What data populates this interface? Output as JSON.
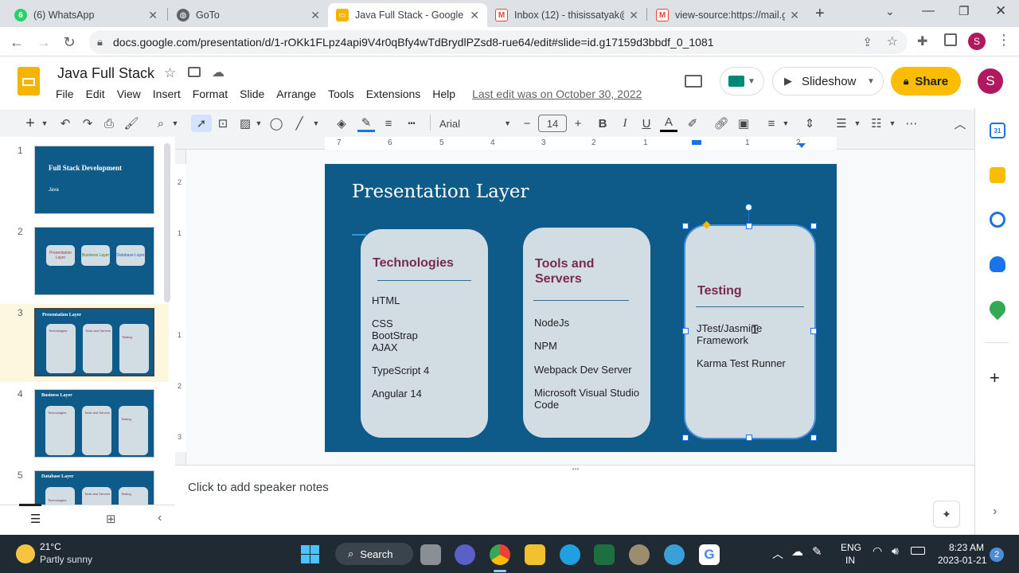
{
  "browser": {
    "tabs": [
      {
        "title": "(6) WhatsApp",
        "icon": "whatsapp-icon",
        "color": "#25d366",
        "badge": "6"
      },
      {
        "title": "GoTo",
        "icon": "globe-icon",
        "color": "#5f6368"
      },
      {
        "title": "Java Full Stack - Google S",
        "icon": "slides-icon",
        "color": "#f4b400",
        "active": true
      },
      {
        "title": "Inbox (12) - thisissatyak@",
        "icon": "gmail-icon",
        "color": "#ea4335"
      },
      {
        "title": "view-source:https://mail.g",
        "icon": "gmail-icon",
        "color": "#ea4335"
      }
    ],
    "url": "docs.google.com/presentation/d/1-rOKk1FLpz4api9V4r0qBfy4wTdBrydlPZsd8-rue64/edit#slide=id.g17159d3bbdf_0_1081",
    "profile_initial": "S"
  },
  "doc": {
    "title": "Java Full Stack",
    "menu": [
      "File",
      "Edit",
      "View",
      "Insert",
      "Format",
      "Slide",
      "Arrange",
      "Tools",
      "Extensions",
      "Help"
    ],
    "last_edit": "Last edit was on October 30, 2022",
    "slideshow_label": "Slideshow",
    "share_label": "Share",
    "avatar_initial": "S"
  },
  "toolbar": {
    "font": "Arial",
    "font_size": "14",
    "minus": "−",
    "plus": "+"
  },
  "ruler": {
    "labels": [
      "7",
      "6",
      "5",
      "4",
      "3",
      "2",
      "1",
      "1",
      "2"
    ],
    "vlabels": [
      "2",
      "1",
      "1",
      "2",
      "3"
    ]
  },
  "filmstrip": {
    "slides": [
      {
        "num": "1",
        "title": "Full Stack Development",
        "subtitle": "Java"
      },
      {
        "num": "2",
        "boxes": [
          "Presentation Layer",
          "Business Layer",
          "Database Layer"
        ]
      },
      {
        "num": "3",
        "title": "Presentation Layer",
        "cols": [
          "Technologies",
          "Tools and Servers",
          "Testing"
        ],
        "selected": true
      },
      {
        "num": "4",
        "title": "Business Layer",
        "cols": [
          "Technologies",
          "Tools and Servers",
          "Testing"
        ]
      },
      {
        "num": "5",
        "title": "Database Layer",
        "cols": [
          "Technologies",
          "Tools and Servers",
          "Testing"
        ]
      }
    ]
  },
  "slide": {
    "title": "Presentation Layer",
    "cards": [
      {
        "title": "Technologies",
        "items": [
          "HTML",
          "CSS\nBootStrap\nAJAX",
          "TypeScript 4",
          "Angular 14"
        ]
      },
      {
        "title": "Tools and\nServers",
        "items": [
          "NodeJs",
          "NPM",
          "Webpack Dev Server",
          "Microsoft Visual Studio\nCode"
        ]
      },
      {
        "title": "Testing",
        "items": [
          "JTest/Jasmine\nFramework",
          "Karma Test Runner"
        ]
      }
    ]
  },
  "notes": {
    "placeholder": "Click to add speaker notes"
  },
  "taskbar": {
    "weather_temp": "21°C",
    "weather_desc": "Partly sunny",
    "search_label": "Search",
    "lang": "ENG",
    "region": "IN",
    "time": "8:23 AM",
    "date": "2023-01-21",
    "notif_count": "2"
  },
  "colors": {
    "slide_bg": "#0e5a89",
    "card_bg": "#d2dde3",
    "card_title": "#7b2a4b",
    "share_bg": "#fbbc04",
    "accent": "#1a73e8"
  }
}
